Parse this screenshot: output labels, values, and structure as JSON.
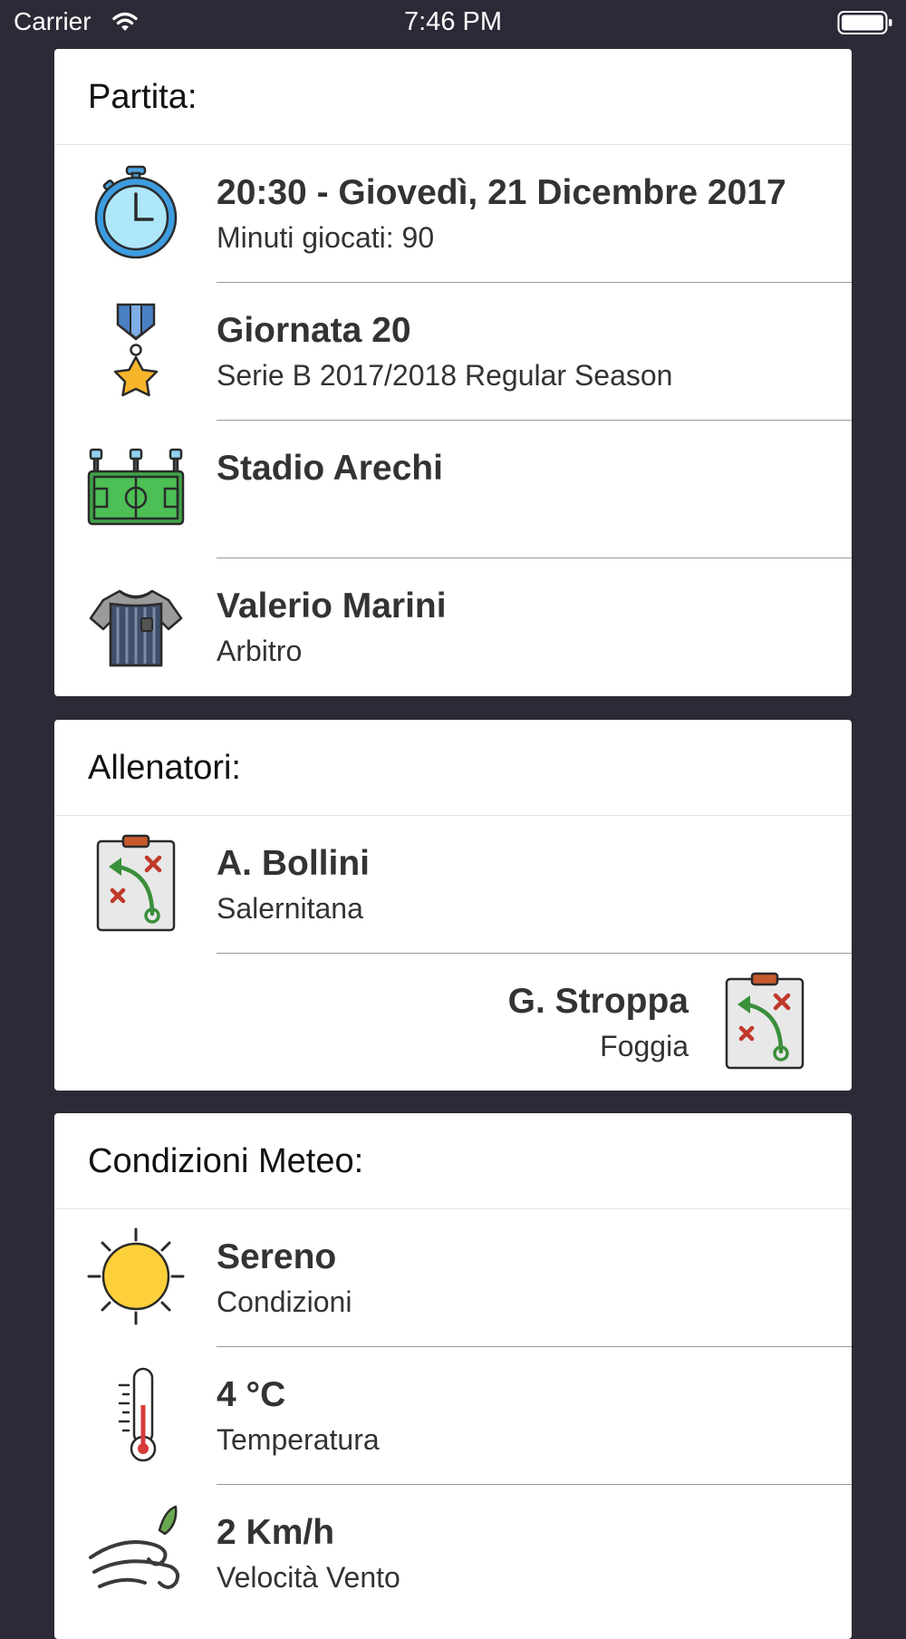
{
  "status_bar": {
    "carrier": "Carrier",
    "time": "7:46 PM"
  },
  "match_card": {
    "header": "Partita:",
    "rows": [
      {
        "icon": "stopwatch-icon",
        "title": "20:30 - Giovedì, 21 Dicembre 2017",
        "subtitle": "Minuti giocati: 90"
      },
      {
        "icon": "medal-icon",
        "title": "Giornata 20",
        "subtitle": "Serie B 2017/2018 Regular Season"
      },
      {
        "icon": "stadium-icon",
        "title": "Stadio Arechi",
        "subtitle": ""
      },
      {
        "icon": "referee-shirt-icon",
        "title": "Valerio Marini",
        "subtitle": "Arbitro"
      }
    ]
  },
  "coaches_card": {
    "header": "Allenatori:",
    "rows": [
      {
        "icon": "tactics-board-icon",
        "title": "A. Bollini",
        "subtitle": "Salernitana"
      },
      {
        "icon": "tactics-board-icon",
        "title": "G. Stroppa",
        "subtitle": "Foggia"
      }
    ]
  },
  "weather_card": {
    "header": "Condizioni Meteo:",
    "rows": [
      {
        "icon": "sun-icon",
        "title": "Sereno",
        "subtitle": "Condizioni"
      },
      {
        "icon": "thermometer-icon",
        "title": "4 °C",
        "subtitle": "Temperatura"
      },
      {
        "icon": "wind-icon",
        "title": "2 Km/h",
        "subtitle": "Velocità Vento"
      }
    ]
  }
}
